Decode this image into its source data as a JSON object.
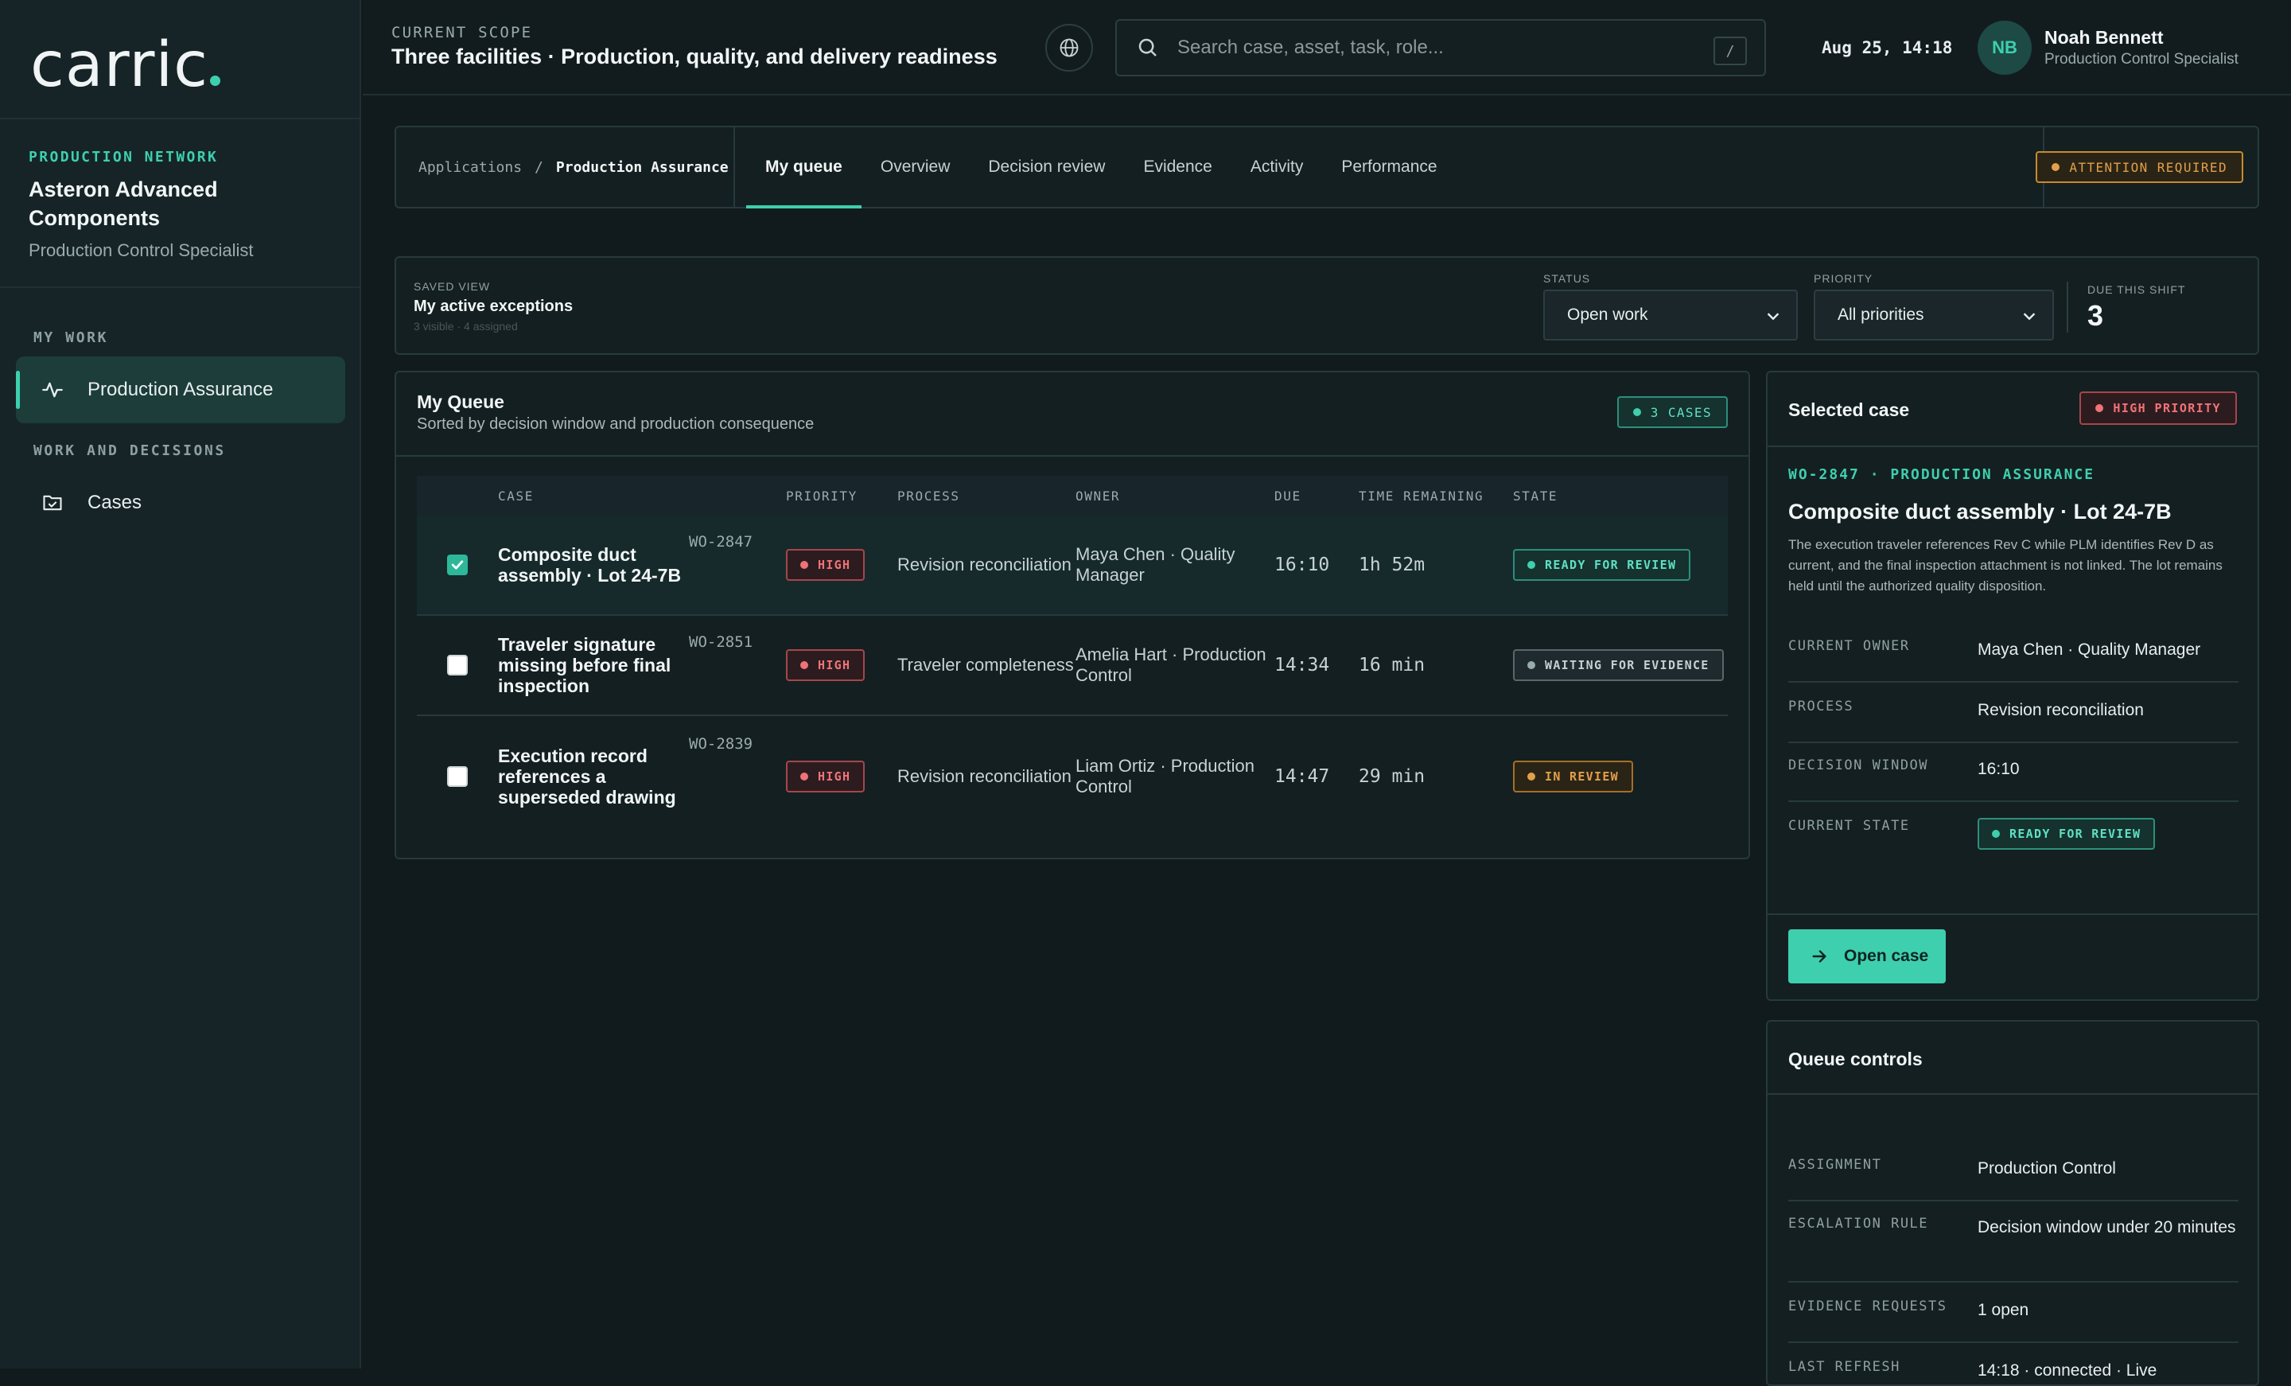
{
  "sidebar": {
    "logo": "carric",
    "org_label": "PRODUCTION NETWORK",
    "org_name": "Asteron Advanced Components",
    "org_role": "Production Control Specialist",
    "section_my_work": "MY WORK",
    "item_production": "Production Assurance",
    "section_work": "WORK AND DECISIONS",
    "item_cases": "Cases"
  },
  "topbar": {
    "scope_label": "CURRENT SCOPE",
    "scope_title": "Three facilities · Production, quality, and delivery readiness",
    "search_placeholder": "Search case, asset, task, role...",
    "search_shortcut": "/",
    "clock": "Aug 25, 14:18",
    "user_initials": "NB",
    "user_name": "Noah Bennett",
    "user_role": "Production Control Specialist"
  },
  "nav": {
    "crumb_root": "Applications",
    "crumb_sep": "/",
    "crumb_current": "Production Assurance",
    "tabs": [
      "My queue",
      "Overview",
      "Decision review",
      "Evidence",
      "Activity",
      "Performance"
    ],
    "attention": "ATTENTION REQUIRED"
  },
  "filters": {
    "saved_view_label": "SAVED VIEW",
    "saved_view_name": "My active exceptions",
    "saved_view_meta": "3 visible · 4 assigned",
    "status_label": "STATUS",
    "status_value": "Open work",
    "priority_label": "PRIORITY",
    "priority_value": "All priorities",
    "due_label": "DUE THIS SHIFT",
    "due_value": "3"
  },
  "queue": {
    "title": "My Queue",
    "subtitle": "Sorted by decision window and production consequence",
    "count": "3 CASES",
    "columns": [
      "CASE",
      "PRIORITY",
      "PROCESS",
      "OWNER",
      "DUE",
      "TIME REMAINING",
      "STATE"
    ],
    "rows": [
      {
        "title": "Composite duct assembly · Lot 24-7B",
        "id": "WO-2847",
        "priority": "HIGH",
        "process": "Revision reconciliation",
        "owner": "Maya Chen · Quality Manager",
        "due": "16:10",
        "remaining": "1h 52m",
        "state": "READY FOR REVIEW"
      },
      {
        "title": "Traveler signature missing before final inspection",
        "id": "WO-2851",
        "priority": "HIGH",
        "process": "Traveler completeness",
        "owner": "Amelia Hart · Production Control",
        "due": "14:34",
        "remaining": "16 min",
        "state": "WAITING FOR EVIDENCE"
      },
      {
        "title": "Execution record references a superseded drawing",
        "id": "WO-2839",
        "priority": "HIGH",
        "process": "Revision reconciliation",
        "owner": "Liam Ortiz · Production Control",
        "due": "14:47",
        "remaining": "29 min",
        "state": "IN REVIEW"
      }
    ]
  },
  "selected": {
    "title": "Selected case",
    "badge": "HIGH PRIORITY",
    "case_id": "WO-2847 · PRODUCTION ASSURANCE",
    "case_title": "Composite duct assembly · Lot 24-7B",
    "description": "The execution traveler references Rev C while PLM identifies Rev D as current, and the final inspection attachment is not linked. The lot remains held until the authorized quality disposition.",
    "owner_label": "CURRENT OWNER",
    "owner_value": "Maya Chen · Quality Manager",
    "process_label": "PROCESS",
    "process_value": "Revision reconciliation",
    "window_label": "DECISION WINDOW",
    "window_value": "16:10",
    "state_label": "CURRENT STATE",
    "state_value": "READY FOR REVIEW",
    "open_button": "Open case"
  },
  "queue_controls": {
    "title": "Queue controls",
    "assignment_label": "ASSIGNMENT",
    "assignment_value": "Production Control",
    "escalation_label": "ESCALATION RULE",
    "escalation_value": "Decision window under 20 minutes",
    "evidence_label": "EVIDENCE REQUESTS",
    "evidence_value": "1 open",
    "refresh_label": "LAST REFRESH",
    "refresh_value": "14:18 · connected · Live"
  }
}
